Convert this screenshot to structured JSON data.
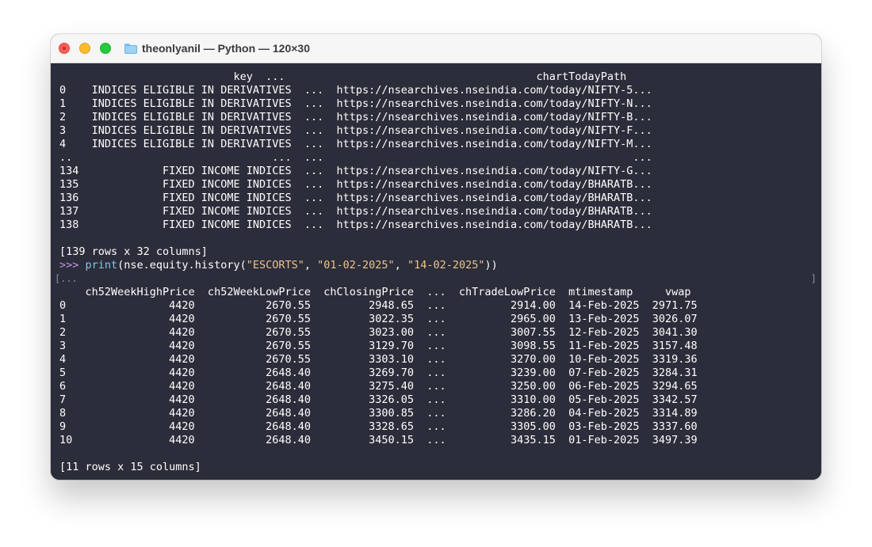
{
  "window": {
    "title": "theonlyanil — Python — 120×30"
  },
  "terminal": {
    "lines": [
      "                           key  ...                                       chartTodayPath",
      "0    INDICES ELIGIBLE IN DERIVATIVES  ...  https://nsearchives.nseindia.com/today/NIFTY-5...",
      "1    INDICES ELIGIBLE IN DERIVATIVES  ...  https://nsearchives.nseindia.com/today/NIFTY-N...",
      "2    INDICES ELIGIBLE IN DERIVATIVES  ...  https://nsearchives.nseindia.com/today/NIFTY-B...",
      "3    INDICES ELIGIBLE IN DERIVATIVES  ...  https://nsearchives.nseindia.com/today/NIFTY-F...",
      "4    INDICES ELIGIBLE IN DERIVATIVES  ...  https://nsearchives.nseindia.com/today/NIFTY-M...",
      "..                               ...  ...                                                ...",
      "134             FIXED INCOME INDICES  ...  https://nsearchives.nseindia.com/today/NIFTY-G...",
      "135             FIXED INCOME INDICES  ...  https://nsearchives.nseindia.com/today/BHARATB...",
      "136             FIXED INCOME INDICES  ...  https://nsearchives.nseindia.com/today/BHARATB...",
      "137             FIXED INCOME INDICES  ...  https://nsearchives.nseindia.com/today/BHARATB...",
      "138             FIXED INCOME INDICES  ...  https://nsearchives.nseindia.com/today/BHARATB...",
      "",
      "[139 rows x 32 columns]"
    ],
    "command": {
      "prompt": ">>> ",
      "func": "print",
      "open": "(nse.equity.history(",
      "arg1": "\"ESCORTS\"",
      "sep1": ", ",
      "arg2": "\"01-02-2025\"",
      "sep2": ", ",
      "arg3": "\"14-02-2025\"",
      "close": "))"
    },
    "continuation": "[...",
    "continuation_end": "]",
    "table_lines": [
      "    ch52WeekHighPrice  ch52WeekLowPrice  chClosingPrice  ...  chTradeLowPrice  mtimestamp     vwap",
      "0                4420           2670.55         2948.65  ...          2914.00  14-Feb-2025  2971.75",
      "1                4420           2670.55         3022.35  ...          2965.00  13-Feb-2025  3026.07",
      "2                4420           2670.55         3023.00  ...          3007.55  12-Feb-2025  3041.30",
      "3                4420           2670.55         3129.70  ...          3098.55  11-Feb-2025  3157.48",
      "4                4420           2670.55         3303.10  ...          3270.00  10-Feb-2025  3319.36",
      "5                4420           2648.40         3269.70  ...          3239.00  07-Feb-2025  3284.31",
      "6                4420           2648.40         3275.40  ...          3250.00  06-Feb-2025  3294.65",
      "7                4420           2648.40         3326.05  ...          3310.00  05-Feb-2025  3342.57",
      "8                4420           2648.40         3300.85  ...          3286.20  04-Feb-2025  3314.89",
      "9                4420           2648.40         3328.65  ...          3305.00  03-Feb-2025  3337.60",
      "10               4420           2648.40         3450.15  ...          3435.15  01-Feb-2025  3497.39",
      "",
      "[11 rows x 15 columns]"
    ]
  },
  "colors": {
    "terminal_bg": "#2b2d3a",
    "prompt": "#c792ea",
    "function": "#82c8e8",
    "string": "#ecc48d"
  }
}
